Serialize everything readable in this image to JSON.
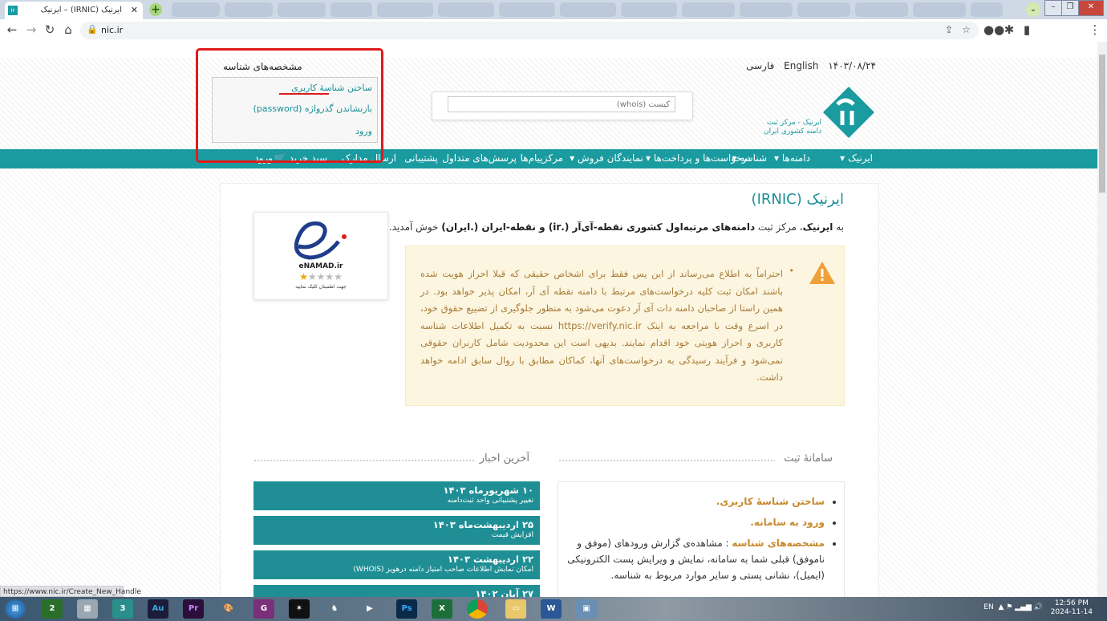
{
  "browser": {
    "active_tab_title": "ایرنیک (IRNIC) – ایرنیک",
    "favicon_text": "ir",
    "url": "nic.ir",
    "status_url": "https://www.nic.ir/Create_New_Handle"
  },
  "header": {
    "date": "۱۴۰۳/۰۸/۲۴",
    "lang_english": "English",
    "lang_farsi": "فارسی",
    "whois_placeholder": "کیست (whois)",
    "logo_line1": "ایرنیک - مرکز ثبت",
    "logo_line2": "دامنه کشوری ایران"
  },
  "handle_menu": {
    "title": "مشخصه‌های شناسه",
    "items": [
      "ساختن شناسهٔ کاربری",
      "بازنشاندن گذرواژه (password)",
      "ورود"
    ]
  },
  "navbar": {
    "items": [
      "ایرنیک",
      "دامنه‌ها",
      "شناسه",
      "درخواست‌ها و پرداخت‌ها",
      "نمایندگان فروش",
      "مرکزپیام‌ها",
      "پرسش‌های متداول",
      "پشتیبانی",
      "ارسال مدارک",
      "سبد خرید",
      "ورود"
    ]
  },
  "main": {
    "title": "ایرنیک (IRNIC)",
    "welcome_prefix": "به",
    "welcome_brand": "ایرنیک",
    "welcome_mid": "، مرکز ثبت",
    "welcome_bold": "دامنه‌های مرتبه‌اول کشوری نقطه-آی‌آر (.ir) و نقطه-ایران (.ایران)",
    "welcome_suffix": "خوش آمدید.",
    "enamad_label": "eNAMAD.ir",
    "enamad_sub": "جهت اطمینان کلیک نمایید",
    "alert_text": "احتراماً به اطلاع می‌رساند از این پس فقط برای اشخاص حقیقی که قبلا احراز هویت شده باشند امکان ثبت کلیه درخواست‌های مرتبط با دامنه نقطه آی آر، امکان پذیر خواهد بود. در همین راستا از صاحبان دامنه دات آی آر دعوت می‌شود به منظور جلوگیری از تضییع حقوق خود، در اسرع وقت با مراجعه به اینک https://verify.nic.ir نسبت به تکمیل اطلاعات شناسه کاربری و احراز هویتی خود اقدام نمایند. بدیهی است این محدودیت شامل کاربران حقوقی نمی‌شود و فرآیند رسیدگی به درخواست‌های آنها، کماکان مطابق با روال سابق ادامه خواهد داشت."
  },
  "register_section": {
    "title": "سامانهٔ ثبت",
    "items": [
      {
        "bold": "ساختن شناسهٔ کاربری.",
        "text": ""
      },
      {
        "bold": "ورود به سامانه.",
        "text": ""
      },
      {
        "bold": "مشخصه‌های شناسه",
        "text": " : مشاهده‌ی گزارش ورودهای (موفق و ناموفق) قبلی شما به سامانه، نمایش و ویرایش پست الکترونیکی (ایمیل)، نشانی پستی و سایر موارد مربوط به شناسه."
      }
    ]
  },
  "news_section": {
    "title": "آخرین اخبار",
    "items": [
      {
        "date": "۱۰ شهریورماه ۱۴۰۳",
        "text": "تغییر پشتیبانی واحد ثبت‌دامنه"
      },
      {
        "date": "۲۵ اردیبهشت‌ماه ۱۴۰۳",
        "text": "افزایش قیمت"
      },
      {
        "date": "۲۲ اردیبهشت ۱۴۰۳",
        "text": "امکان نمایش اطلاعات صاحب امتیاز دامنه درهویز (WHOIS)"
      },
      {
        "date": "۲۷ آبان ۱۴۰۲",
        "text": ""
      }
    ]
  },
  "taskbar": {
    "lang": "EN",
    "time": "12:56 PM",
    "date": "2024-11-14"
  },
  "colors": {
    "brand": "#1a9ba0",
    "highlight": "#e01b1b",
    "alert_bg": "#fcf5df"
  }
}
